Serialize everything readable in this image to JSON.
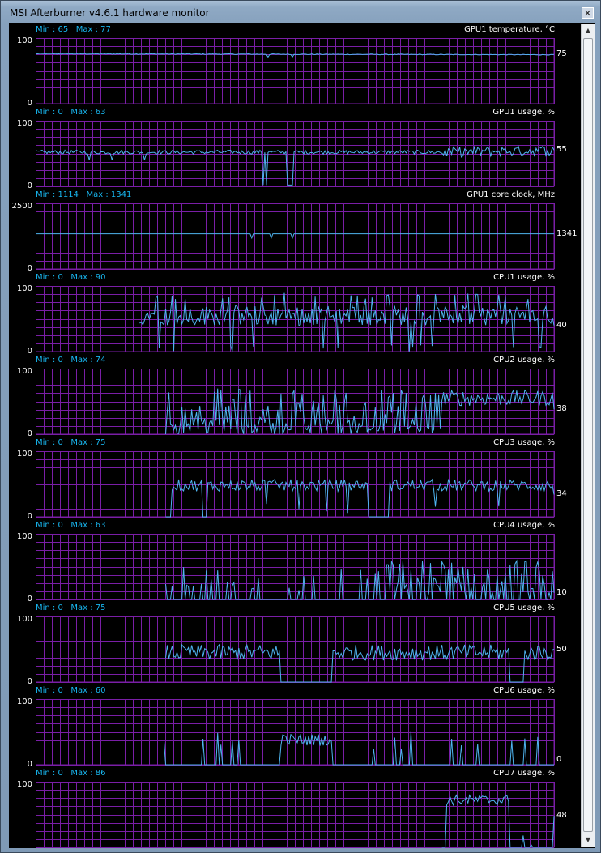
{
  "window": {
    "title": "MSI Afterburner v4.6.1 hardware monitor",
    "close_glyph": "✕"
  },
  "colors": {
    "grid": "#7a1ea6",
    "plot_bg": "#000000",
    "line": "#4fb4f0",
    "minmax_text": "#18b6ef",
    "label_text": "#ffffff"
  },
  "graphs": [
    {
      "name": "GPU1 temperature, °C",
      "min_label": "Min : 65",
      "max_label": "Max : 77",
      "y_top": "100",
      "y_bottom": "0",
      "ymax": 100,
      "current": "75",
      "current_value": 75,
      "profile": "temp"
    },
    {
      "name": "GPU1 usage, %",
      "min_label": "Min : 0",
      "max_label": "Max : 63",
      "y_top": "100",
      "y_bottom": "0",
      "ymax": 100,
      "current": "55",
      "current_value": 55,
      "profile": "gpu"
    },
    {
      "name": "GPU1 core clock, MHz",
      "min_label": "Min : 1114",
      "max_label": "Max : 1341",
      "y_top": "2500",
      "y_bottom": "0",
      "ymax": 2500,
      "current": "1341",
      "current_value": 1341,
      "profile": "clock"
    },
    {
      "name": "CPU1 usage, %",
      "min_label": "Min : 0",
      "max_label": "Max : 90",
      "y_top": "100",
      "y_bottom": "0",
      "ymax": 100,
      "current": "40",
      "current_value": 40,
      "profile": "cpu1"
    },
    {
      "name": "CPU2 usage, %",
      "min_label": "Min : 0",
      "max_label": "Max : 74",
      "y_top": "100",
      "y_bottom": "0",
      "ymax": 100,
      "current": "38",
      "current_value": 38,
      "profile": "cpu2"
    },
    {
      "name": "CPU3 usage, %",
      "min_label": "Min : 0",
      "max_label": "Max : 75",
      "y_top": "100",
      "y_bottom": "0",
      "ymax": 100,
      "current": "34",
      "current_value": 34,
      "profile": "cpu3"
    },
    {
      "name": "CPU4 usage, %",
      "min_label": "Min : 0",
      "max_label": "Max : 63",
      "y_top": "100",
      "y_bottom": "0",
      "ymax": 100,
      "current": "10",
      "current_value": 10,
      "profile": "cpu4"
    },
    {
      "name": "CPU5 usage, %",
      "min_label": "Min : 0",
      "max_label": "Max : 75",
      "y_top": "100",
      "y_bottom": "0",
      "ymax": 100,
      "current": "50",
      "current_value": 50,
      "profile": "cpu5"
    },
    {
      "name": "CPU6 usage, %",
      "min_label": "Min : 0",
      "max_label": "Max : 60",
      "y_top": "100",
      "y_bottom": "0",
      "ymax": 100,
      "current": "0",
      "current_value": 0,
      "profile": "cpu6"
    },
    {
      "name": "CPU7 usage, %",
      "min_label": "Min : 0",
      "max_label": "Max : 86",
      "y_top": "100",
      "y_bottom": "0",
      "ymax": 100,
      "current": "48",
      "current_value": 48,
      "profile": "cpu7"
    }
  ]
}
